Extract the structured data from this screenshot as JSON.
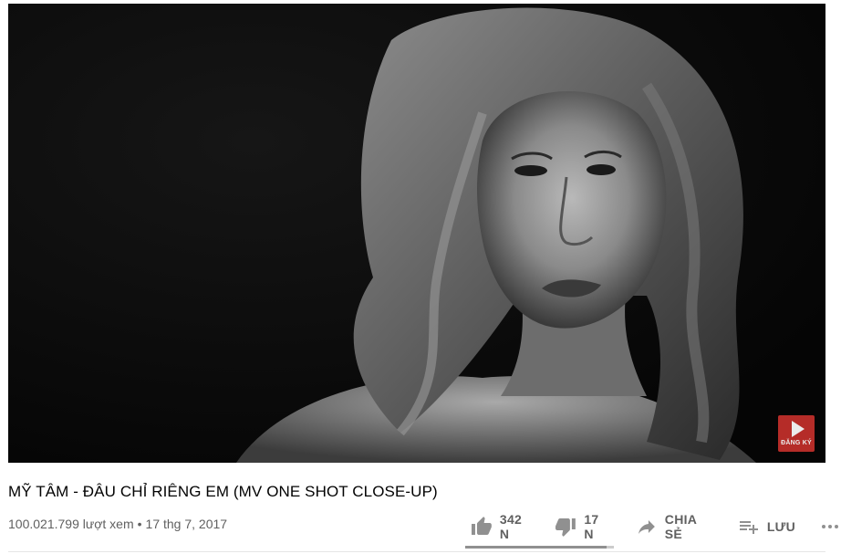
{
  "player": {
    "thumbnail_icon": "portrait-image",
    "watermark": {
      "label": "ĐĂNG KÝ",
      "icon": "play-icon",
      "color": "#c4302b"
    }
  },
  "video": {
    "title": "MỸ TÂM - ĐÂU CHỈ RIÊNG EM (MV ONE SHOT CLOSE-UP)",
    "views": "100.021.799 lượt xem",
    "separator": "•",
    "date": "17 thg 7, 2017"
  },
  "actions": {
    "like": {
      "icon": "thumbs-up-icon",
      "label": "342 N"
    },
    "dislike": {
      "icon": "thumbs-down-icon",
      "label": "17 N"
    },
    "share": {
      "icon": "share-icon",
      "label": "CHIA SẺ"
    },
    "save": {
      "icon": "playlist-add-icon",
      "label": "LƯU"
    },
    "more": {
      "icon": "more-horizontal-icon"
    }
  },
  "sentiment": {
    "like_fraction": 0.95
  },
  "colors": {
    "text_primary": "#030303",
    "text_secondary": "#606060",
    "icon": "#909090",
    "bar_track": "#cccccc"
  }
}
